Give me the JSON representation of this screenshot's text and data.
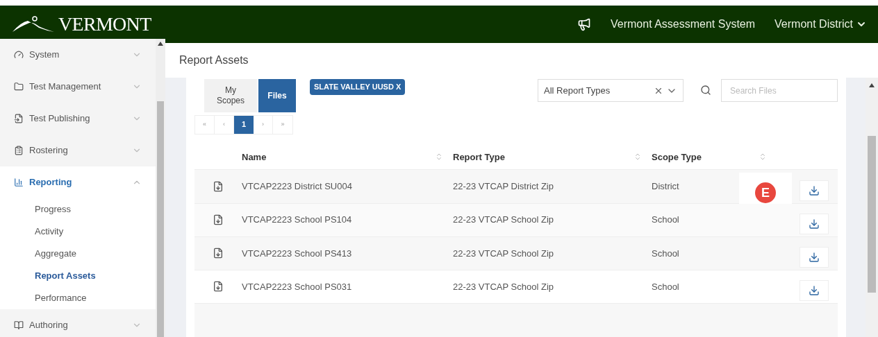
{
  "header": {
    "logo": "VERMONT",
    "app_title": "Vermont Assessment System",
    "user_menu": "Vermont District"
  },
  "sidebar": {
    "items": [
      {
        "label": "System",
        "expanded": false
      },
      {
        "label": "Test Management",
        "expanded": false
      },
      {
        "label": "Test Publishing",
        "expanded": false
      },
      {
        "label": "Rostering",
        "expanded": false
      },
      {
        "label": "Reporting",
        "expanded": true,
        "children": [
          {
            "label": "Progress",
            "selected": false
          },
          {
            "label": "Activity",
            "selected": false
          },
          {
            "label": "Aggregate",
            "selected": false
          },
          {
            "label": "Report Assets",
            "selected": true
          },
          {
            "label": "Performance",
            "selected": false
          }
        ]
      },
      {
        "label": "Authoring",
        "expanded": false
      }
    ]
  },
  "page_title": "Report Assets",
  "view_toggle": [
    {
      "label": "My Scopes",
      "selected": false
    },
    {
      "label": "Files",
      "selected": true
    }
  ],
  "filter_chip": "SLATE VALLEY UUSD X",
  "report_type_select": {
    "value": "All Report Types"
  },
  "search": {
    "placeholder": "Search Files"
  },
  "pagination": {
    "first": "«",
    "prev": "‹",
    "pages": [
      {
        "label": "1",
        "selected": true
      }
    ],
    "next": "›",
    "last": "»"
  },
  "table": {
    "columns": [
      "Name",
      "Report Type",
      "Scope Type"
    ],
    "rows": [
      {
        "name": "VTCAP2223 District SU004",
        "report_type": "22-23 VTCAP District Zip",
        "scope_type": "District"
      },
      {
        "name": "VTCAP2223 School PS104",
        "report_type": "22-23 VTCAP School Zip",
        "scope_type": "School"
      },
      {
        "name": "VTCAP2223 School PS413",
        "report_type": "22-23 VTCAP School Zip",
        "scope_type": "School"
      },
      {
        "name": "VTCAP2223 School PS031",
        "report_type": "22-23 VTCAP School Zip",
        "scope_type": "School"
      }
    ]
  },
  "overlay_badge": "E"
}
